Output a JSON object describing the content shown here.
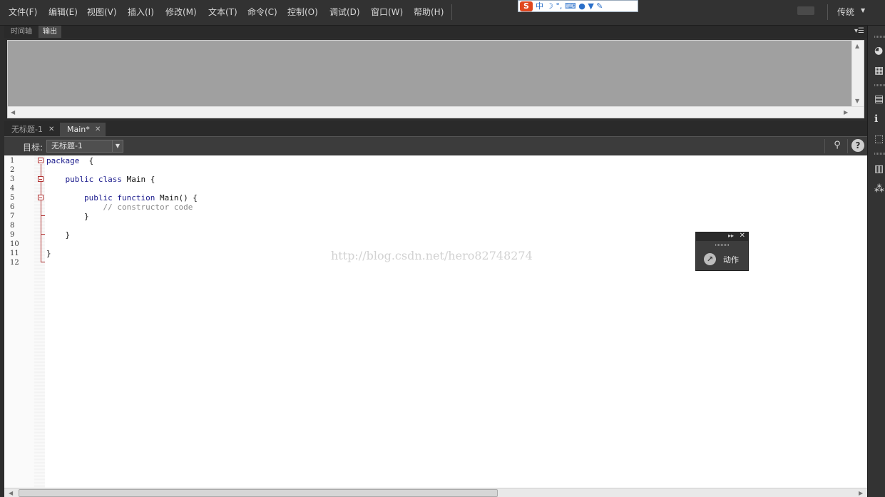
{
  "menubar": {
    "items": [
      "文件(F)",
      "编辑(E)",
      "视图(V)",
      "插入(I)",
      "修改(M)",
      "文本(T)",
      "命令(C)",
      "控制(O)",
      "调试(D)",
      "窗口(W)",
      "帮助(H)"
    ],
    "workspace": "传统"
  },
  "ime": {
    "logo": "S",
    "mode": "中",
    "glyphs": "☽ °, ⌨ ● ▼ ✎"
  },
  "output_panel": {
    "tabs": [
      "时间轴",
      "输出"
    ],
    "active_tab": "输出"
  },
  "doc_tabs": [
    {
      "label": "无标题-1"
    },
    {
      "label": "Main*"
    }
  ],
  "target": {
    "label": "目标:",
    "value": "无标题-1"
  },
  "editor": {
    "line_numbers": [
      "1",
      "2",
      "3",
      "4",
      "5",
      "6",
      "7",
      "8",
      "9",
      "10",
      "11",
      "12"
    ],
    "lines": [
      {
        "pre": "",
        "kw": "package",
        "post": "  {"
      },
      {
        "pre": "",
        "kw": "",
        "post": ""
      },
      {
        "pre": "    ",
        "kw": "public class",
        "post": " Main {"
      },
      {
        "pre": "",
        "kw": "",
        "post": ""
      },
      {
        "pre": "        ",
        "kw": "public function",
        "post": " Main() {"
      },
      {
        "pre": "            ",
        "kw": "",
        "post": "// constructor code"
      },
      {
        "pre": "        ",
        "kw": "",
        "post": "}"
      },
      {
        "pre": "",
        "kw": "",
        "post": ""
      },
      {
        "pre": "    ",
        "kw": "",
        "post": "}"
      },
      {
        "pre": "",
        "kw": "",
        "post": ""
      },
      {
        "pre": "",
        "kw": "",
        "post": "}"
      },
      {
        "pre": "",
        "kw": "",
        "post": ""
      }
    ],
    "watermark": "http://blog.csdn.net/hero82748274"
  },
  "floating_panel": {
    "button_label": "动作"
  }
}
